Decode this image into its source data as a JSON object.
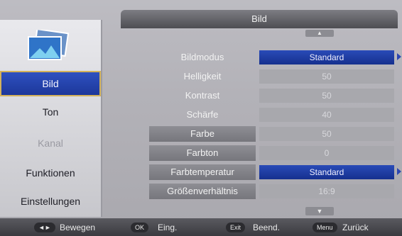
{
  "header": {
    "title": "Bild"
  },
  "sidebar": {
    "items": [
      {
        "label": "Bild",
        "state": "active"
      },
      {
        "label": "Ton",
        "state": "normal"
      },
      {
        "label": "Kanal",
        "state": "disabled"
      },
      {
        "label": "Funktionen",
        "state": "normal"
      },
      {
        "label": "Einstellungen",
        "state": "normal"
      }
    ]
  },
  "settings": [
    {
      "label": "Bildmodus",
      "value": "Standard",
      "selectable": true
    },
    {
      "label": "Helligkeit",
      "value": "50",
      "selectable": false
    },
    {
      "label": "Kontrast",
      "value": "50",
      "selectable": false
    },
    {
      "label": "Schärfe",
      "value": "40",
      "selectable": false
    },
    {
      "label": "Farbe",
      "value": "50",
      "selectable": false
    },
    {
      "label": "Farbton",
      "value": "0",
      "selectable": false
    },
    {
      "label": "Farbtemperatur",
      "value": "Standard",
      "selectable": true
    },
    {
      "label": "Größenverhältnis",
      "value": "16:9",
      "selectable": false
    }
  ],
  "footer": {
    "keys": [
      {
        "key": "◄►",
        "label": "Bewegen"
      },
      {
        "key": "OK",
        "label": "Eing."
      },
      {
        "key": "Exit",
        "label": "Beend."
      },
      {
        "key": "Menu",
        "label": "Zurück"
      }
    ]
  },
  "colors": {
    "accent": "#1f3aa0",
    "highlight_border": "#d3b25a"
  },
  "icons": {
    "sidebar_picture": "picture-icon"
  }
}
